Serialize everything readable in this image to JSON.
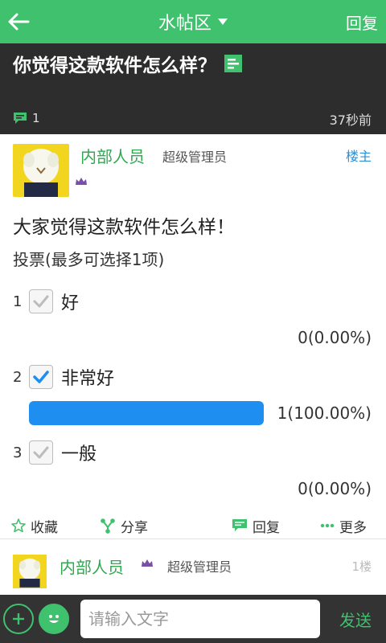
{
  "topbar": {
    "title": "水帖区",
    "reply_label": "回复"
  },
  "thread": {
    "title": "你觉得这款软件怎么样？",
    "comment_count": "1",
    "time": "37秒前"
  },
  "post": {
    "author": "内部人员",
    "role": "超级管理员",
    "floor": "楼主",
    "text": "大家觉得这款软件怎么样！",
    "vote_rule": "投票(最多可选择1项)",
    "options": [
      {
        "num": "1",
        "label": "好",
        "checked": false,
        "result": "0(0.00%)",
        "fraction": 0.0
      },
      {
        "num": "2",
        "label": "非常好",
        "checked": true,
        "result": "1(100.00%)",
        "fraction": 1.0
      },
      {
        "num": "3",
        "label": "一般",
        "checked": false,
        "result": "0(0.00%)",
        "fraction": 0.0
      }
    ]
  },
  "actions": {
    "favorite": "收藏",
    "share": "分享",
    "reply": "回复",
    "more": "更多"
  },
  "post2": {
    "author": "内部人员",
    "role": "超级管理员",
    "floor": "1楼"
  },
  "bottom": {
    "input_placeholder": "请输入文字",
    "send_label": "发送"
  },
  "colors": {
    "accent": "#3fc16d",
    "header_dark": "#2d2d2d",
    "vote_bar": "#1e8ff0",
    "floor_main": "#2b8fd8"
  }
}
